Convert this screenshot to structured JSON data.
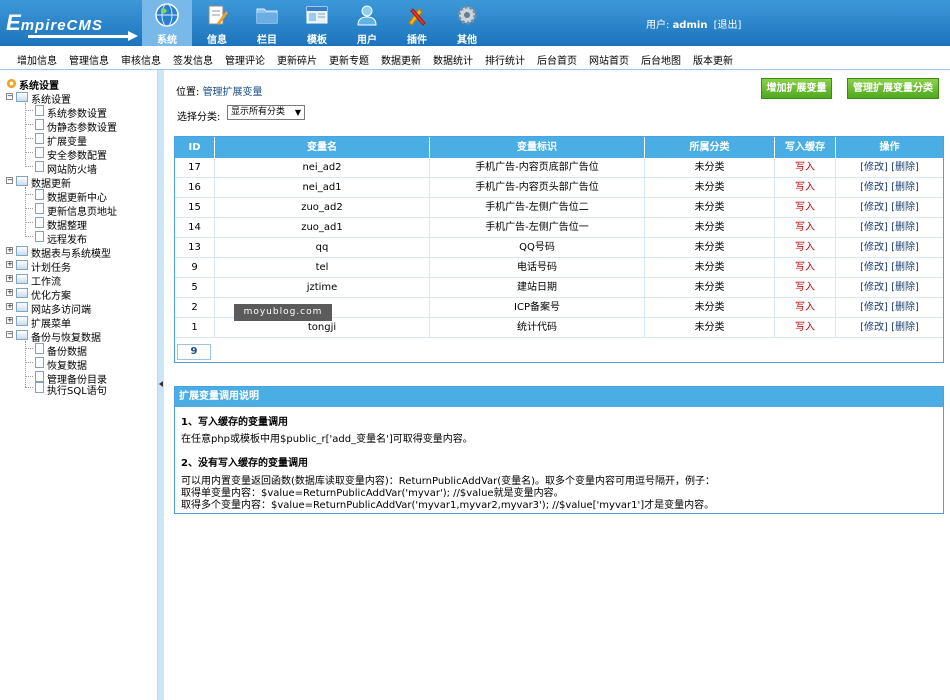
{
  "app": {
    "logo_first": "E",
    "logo_rest": "mpireCMS"
  },
  "nav": {
    "tabs": [
      {
        "label": "系统",
        "icon": "globe-icon"
      },
      {
        "label": "信息",
        "icon": "edit-icon"
      },
      {
        "label": "栏目",
        "icon": "folder-icon"
      },
      {
        "label": "模板",
        "icon": "template-icon"
      },
      {
        "label": "用户",
        "icon": "user-icon"
      },
      {
        "label": "插件",
        "icon": "plugin-icon"
      },
      {
        "label": "其他",
        "icon": "gear-icon"
      }
    ],
    "active": "系统"
  },
  "user": {
    "label": "用户:",
    "name": "admin",
    "logout": "[退出]"
  },
  "menubar": [
    "增加信息",
    "管理信息",
    "审核信息",
    "签发信息",
    "管理评论",
    "更新碎片",
    "更新专题",
    "数据更新",
    "数据统计",
    "排行统计",
    "后台首页",
    "网站首页",
    "后台地图",
    "版本更新"
  ],
  "sidebar": {
    "root": "系统设置",
    "groups": [
      {
        "label": "系统设置",
        "children": [
          "系统参数设置",
          "伪静态参数设置",
          "扩展变量",
          "安全参数配置",
          "网站防火墙"
        ]
      },
      {
        "label": "数据更新",
        "children": [
          "数据更新中心",
          "更新信息页地址",
          "数据整理",
          "远程发布"
        ]
      },
      {
        "label": "数据表与系统模型",
        "children": []
      },
      {
        "label": "计划任务",
        "children": []
      },
      {
        "label": "工作流",
        "children": []
      },
      {
        "label": "优化方案",
        "children": []
      },
      {
        "label": "网站多访问端",
        "children": []
      },
      {
        "label": "扩展菜单",
        "children": []
      },
      {
        "label": "备份与恢复数据",
        "children": [
          "备份数据",
          "恢复数据",
          "管理备份目录",
          "执行SQL语句"
        ]
      }
    ]
  },
  "main": {
    "position_label": "位置:",
    "position_link": "管理扩展变量",
    "add_button": "增加扩展变量",
    "manage_class_button": "管理扩展变量分类",
    "filter_label": "选择分类:",
    "filter_value": "显示所有分类",
    "table": {
      "headers": [
        "ID",
        "变量名",
        "变量标识",
        "所属分类",
        "写入缓存",
        "操作"
      ],
      "rows": [
        {
          "id": "17",
          "name": "nei_ad2",
          "mark": "手机广告-内容页底部广告位",
          "class": "未分类",
          "cache": "写入",
          "edit": "[修改]",
          "del": "[删除]"
        },
        {
          "id": "16",
          "name": "nei_ad1",
          "mark": "手机广告-内容页头部广告位",
          "class": "未分类",
          "cache": "写入",
          "edit": "[修改]",
          "del": "[删除]"
        },
        {
          "id": "15",
          "name": "zuo_ad2",
          "mark": "手机广告-左侧广告位二",
          "class": "未分类",
          "cache": "写入",
          "edit": "[修改]",
          "del": "[删除]"
        },
        {
          "id": "14",
          "name": "zuo_ad1",
          "mark": "手机广告-左侧广告位一",
          "class": "未分类",
          "cache": "写入",
          "edit": "[修改]",
          "del": "[删除]"
        },
        {
          "id": "13",
          "name": "qq",
          "mark": "QQ号码",
          "class": "未分类",
          "cache": "写入",
          "edit": "[修改]",
          "del": "[删除]"
        },
        {
          "id": "9",
          "name": "tel",
          "mark": "电话号码",
          "class": "未分类",
          "cache": "写入",
          "edit": "[修改]",
          "del": "[删除]"
        },
        {
          "id": "5",
          "name": "jztime",
          "mark": "建站日期",
          "class": "未分类",
          "cache": "写入",
          "edit": "[修改]",
          "del": "[删除]"
        },
        {
          "id": "2",
          "name": "",
          "mark": "ICP备案号",
          "class": "未分类",
          "cache": "写入",
          "edit": "[修改]",
          "del": "[删除]"
        },
        {
          "id": "1",
          "name": "tongji",
          "mark": "统计代码",
          "class": "未分类",
          "cache": "写入",
          "edit": "[修改]",
          "del": "[删除]"
        }
      ]
    },
    "pager": "9",
    "watermark": "moyublog.com"
  },
  "help": {
    "title": "扩展变量调用说明",
    "s1_title": "1、写入缓存的变量调用",
    "s1_text": "在任意php或模板中用$public_r['add_变量名']可取得变量内容。",
    "s2_title": "2、没有写入缓存的变量调用",
    "s2_line1": "可以用内置变量返回函数(数据库读取变量内容)：ReturnPublicAddVar(变量名)。取多个变量内容可用逗号隔开，例子：",
    "s2_line2": "取得单变量内容：$value=ReturnPublicAddVar('myvar'); //$value就是变量内容。",
    "s2_line3": "取得多个变量内容：$value=ReturnPublicAddVar('myvar1,myvar2,myvar3'); //$value['myvar1']才是变量内容。"
  }
}
